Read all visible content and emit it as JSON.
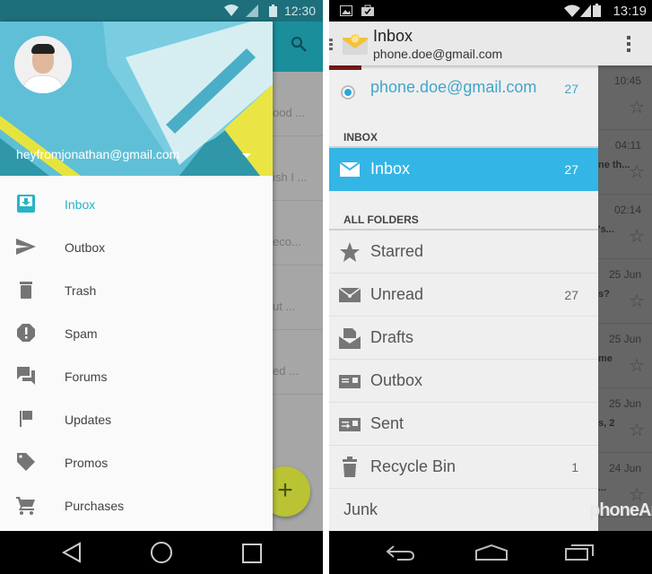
{
  "left": {
    "status_bar": {
      "time": "12:30",
      "icons": [
        "wifi-icon",
        "signal-icon",
        "battery-icon"
      ]
    },
    "drawer": {
      "account_email": "heyfromjonathan@gmail.com",
      "items": [
        {
          "label": "Inbox",
          "icon": "inbox-icon",
          "active": true
        },
        {
          "label": "Outbox",
          "icon": "send-icon",
          "active": false
        },
        {
          "label": "Trash",
          "icon": "trash-icon",
          "active": false
        },
        {
          "label": "Spam",
          "icon": "spam-icon",
          "active": false
        },
        {
          "label": "Forums",
          "icon": "forum-icon",
          "active": false
        },
        {
          "label": "Updates",
          "icon": "flag-icon",
          "active": false
        },
        {
          "label": "Promos",
          "icon": "tag-icon",
          "active": false
        },
        {
          "label": "Purchases",
          "icon": "cart-icon",
          "active": false
        }
      ]
    },
    "background_snippets": [
      "ood ...",
      "ish I ...",
      "eco...",
      "ut ...",
      "ed ..."
    ],
    "fab_label": "+",
    "accent_color": "#27b3c8"
  },
  "right": {
    "status_bar": {
      "time": "13:19",
      "icons": [
        "image-icon",
        "shopping-bag-icon",
        "wifi-icon",
        "signal-icon",
        "battery-icon"
      ]
    },
    "appbar": {
      "title": "Inbox",
      "subtitle": "phone.doe@gmail.com"
    },
    "account": {
      "email": "phone.doe@gmail.com",
      "count": "27"
    },
    "inbox_section": "INBOX",
    "selected": {
      "label": "Inbox",
      "count": "27"
    },
    "all_folders_section": "ALL FOLDERS",
    "folders": [
      {
        "label": "Starred",
        "count": "",
        "icon": "star-icon"
      },
      {
        "label": "Unread",
        "count": "27",
        "icon": "unread-envelope-icon"
      },
      {
        "label": "Drafts",
        "count": "",
        "icon": "drafts-icon"
      },
      {
        "label": "Outbox",
        "count": "",
        "icon": "outbox-icon"
      },
      {
        "label": "Sent",
        "count": "",
        "icon": "sent-icon"
      },
      {
        "label": "Recycle Bin",
        "count": "1",
        "icon": "recycle-bin-icon"
      },
      {
        "label": "Junk",
        "count": "",
        "icon": ""
      }
    ],
    "background_rows": [
      {
        "time": "10:45",
        "snippet": ""
      },
      {
        "time": "04:11",
        "snippet": "ne th..."
      },
      {
        "time": "02:14",
        "snippet": "'s..."
      },
      {
        "time": "25 Jun",
        "snippet": "s?"
      },
      {
        "time": "25 Jun",
        "snippet": "me"
      },
      {
        "time": "25 Jun",
        "snippet": "s, 2"
      },
      {
        "time": "24 Jun",
        "snippet": "..."
      }
    ],
    "watermark": "phoneArena",
    "accent_color": "#33b5e5"
  }
}
